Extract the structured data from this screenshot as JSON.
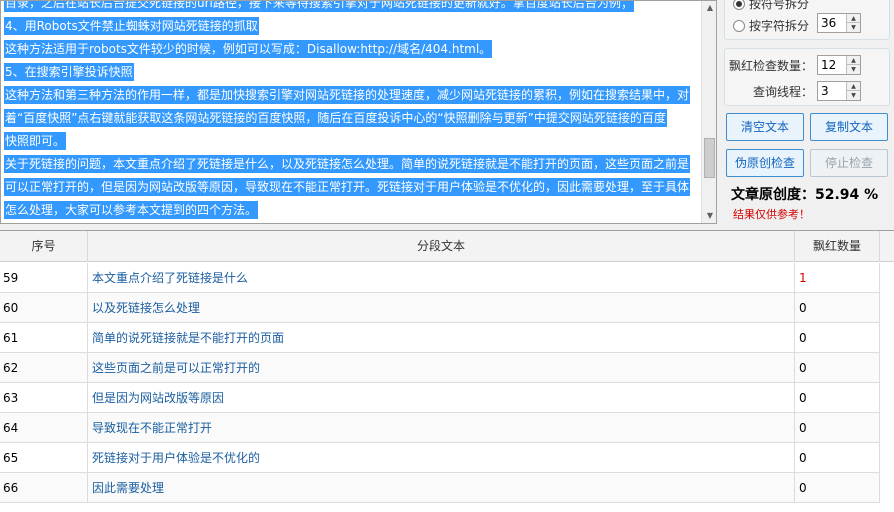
{
  "article": {
    "lines": [
      "目录，之后在站长后台提交死链接的url路径，接下来等待搜索引擎对于网站死链接的更新就好。拿百度站长后台为例；",
      "4、用Robots文件禁止蜘蛛对网站死链接的抓取",
      "这种方法适用于robots文件较少的时候，例如可以写成：Disallow:http://域名/404.html。",
      "5、在搜索引擎投诉快照",
      "这种方法和第三种方法的作用一样，都是加快搜索引擎对网站死链接的处理速度，减少网站死链接的累积，例如在搜索结果中，对",
      "着“百度快照”点右键就能获取这条网站死链接的百度快照，随后在百度投诉中心的“快照删除与更新”中提交网站死链接的百度",
      "快照即可。",
      "关于死链接的问题，本文重点介绍了死链接是什么，以及死链接怎么处理。简单的说死链接就是不能打开的页面，这些页面之前是",
      "可以正常打开的，但是因为网站改版等原因，导致现在不能正常打开。死链接对于用户体验是不优化的，因此需要处理，至于具体",
      "怎么处理，大家可以参考本文提到的四个方法。"
    ]
  },
  "options": {
    "split_by_punct_label": "按符号拆分",
    "split_by_chars_label": "按字符拆分",
    "split_chars_value": "36",
    "hot_check_count_label": "飘红检查数量：",
    "hot_check_count_value": "12",
    "query_threads_label": "查询线程：",
    "query_threads_value": "3"
  },
  "buttons": {
    "clear_text": "清空文本",
    "copy_text": "复制文本",
    "check_originality": "伪原创检查",
    "stop_check": "停止检查"
  },
  "result": {
    "originality_label": "文章原创度：52.94 %",
    "note": "结果仅供参考！"
  },
  "table": {
    "headers": {
      "index": "序号",
      "segment": "分段文本",
      "hot_count": "飘红数量"
    },
    "rows": [
      {
        "index": "59",
        "segment": "本文重点介绍了死链接是什么",
        "hot_count": "1"
      },
      {
        "index": "60",
        "segment": "以及死链接怎么处理",
        "hot_count": "0"
      },
      {
        "index": "61",
        "segment": "简单的说死链接就是不能打开的页面",
        "hot_count": "0"
      },
      {
        "index": "62",
        "segment": "这些页面之前是可以正常打开的",
        "hot_count": "0"
      },
      {
        "index": "63",
        "segment": "但是因为网站改版等原因",
        "hot_count": "0"
      },
      {
        "index": "64",
        "segment": "导致现在不能正常打开",
        "hot_count": "0"
      },
      {
        "index": "65",
        "segment": "死链接对于用户体验是不优化的",
        "hot_count": "0"
      },
      {
        "index": "66",
        "segment": "因此需要处理",
        "hot_count": "0"
      }
    ]
  },
  "colors": {
    "selection": "#3399ff",
    "hot_count": "#e00000",
    "segment_text": "#1b5ea0",
    "note": "#d40000"
  }
}
